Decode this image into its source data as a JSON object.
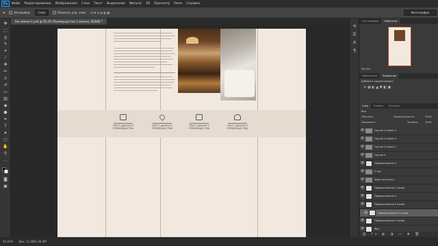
{
  "menu": {
    "logo": "Ps",
    "items": [
      "Файл",
      "Редактирование",
      "Изображение",
      "Слои",
      "Текст",
      "Выделение",
      "Фильтр",
      "3D",
      "Просмотр",
      "Окно",
      "Справка"
    ]
  },
  "options": {
    "autoselect_label": "Автовыбор:",
    "autoselect_value": "Слой",
    "transform_label": "Показать упр. элем."
  },
  "workspace": "Фотография",
  "document_tab": "Без имени-1.psd @ 56,4% (Преимущество 1 иконка, RGB/8) *",
  "status": {
    "zoom": "56,43%",
    "doc_size": "Док: 11,4M/1,26,4M"
  },
  "page": {
    "benefits": [
      {
        "icon": "chef-icon",
        "line1": "ТЕКСТ ДАННОГО",
        "line2": "ПРЕИМУЩЕСТВА"
      },
      {
        "icon": "heart-icon",
        "line1": "ТЕКСТ ДАННОГО",
        "line2": "ПРЕИМУЩЕСТВА"
      },
      {
        "icon": "box-icon",
        "line1": "ТЕКСТ ДАННОГО",
        "line2": "ПРЕИМУЩЕСТВА"
      },
      {
        "icon": "wifi-icon",
        "line1": "ТЕКСТ ДАННОГО",
        "line2": "ПРЕИМУЩЕСТВА"
      }
    ]
  },
  "panels": {
    "top_tabs": [
      "Гистограмма",
      "Навигатор"
    ],
    "zoom": "56,43%",
    "mid_tabs": [
      "Библиотеки",
      "Коррекция"
    ],
    "correction_title": "Добавить корректировку",
    "layer_tabs": [
      "Слои",
      "Каналы",
      "Контуры"
    ],
    "kind": "Вид",
    "blend": "Обычные",
    "opacity_label": "Непрозрачность:",
    "opacity": "100%",
    "lock_label": "Закрепить:",
    "fill_label": "Заливка:",
    "fill": "100%",
    "layers": [
      {
        "name": "Группа 4 копия 4",
        "type": "folder"
      },
      {
        "name": "Группа 4 копия 3",
        "type": "folder"
      },
      {
        "name": "Группа 4 копия 2",
        "type": "folder"
      },
      {
        "name": "Группа 4",
        "type": "folder"
      },
      {
        "name": "Прямоугольник 5",
        "type": "layer"
      },
      {
        "name": "О нас",
        "type": "folder"
      },
      {
        "name": "Slider and menu",
        "type": "folder"
      },
      {
        "name": "Прямоугольник 1 копия",
        "type": "layer"
      },
      {
        "name": "Прямоугольник 1",
        "type": "layer"
      },
      {
        "name": "Прямоугольник 4 копия",
        "type": "layer"
      },
      {
        "name": "Прямоугольник 2 копия",
        "type": "layer"
      },
      {
        "name": "Прямоугольник 2 копия",
        "type": "layer"
      },
      {
        "name": "Фон",
        "type": "layer"
      }
    ]
  }
}
